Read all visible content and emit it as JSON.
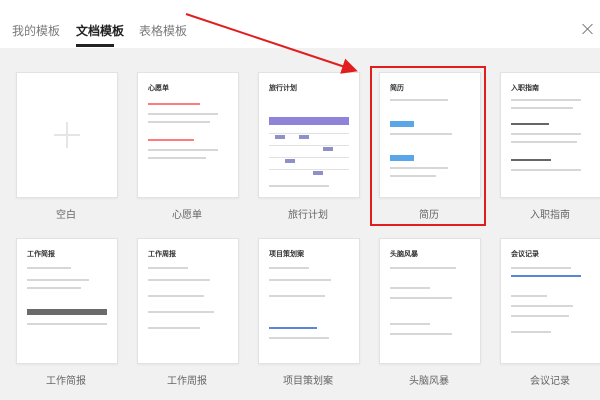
{
  "tabs": {
    "items": [
      {
        "id": "mine",
        "label": "我的模板"
      },
      {
        "id": "docs",
        "label": "文档模板"
      },
      {
        "id": "sheets",
        "label": "表格模板"
      }
    ],
    "active": "docs"
  },
  "templates_row1": [
    {
      "id": "blank",
      "label": "空白"
    },
    {
      "id": "wishlist",
      "label": "心愿单",
      "card_title": "心愿单"
    },
    {
      "id": "travel",
      "label": "旅行计划",
      "card_title": "旅行计划"
    },
    {
      "id": "resume",
      "label": "简历",
      "card_title": "简历"
    },
    {
      "id": "onboarding",
      "label": "入职指南",
      "card_title": "入职指南"
    }
  ],
  "templates_row2": [
    {
      "id": "weekly-report-1",
      "label": "工作简报",
      "card_title": "工作简报"
    },
    {
      "id": "weekly-report-2",
      "label": "工作周报",
      "card_title": "工作周报"
    },
    {
      "id": "project-plan",
      "label": "项目策划案",
      "card_title": "项目策划案"
    },
    {
      "id": "brainstorm",
      "label": "头脑风暴",
      "card_title": "头脑风暴"
    },
    {
      "id": "meeting-notes",
      "label": "会议记录",
      "card_title": "会议记录"
    }
  ],
  "colors": {
    "highlight": "#e11d1d",
    "active_tab": "#222222"
  },
  "icons": {
    "close": "close-icon",
    "add": "plus-icon"
  }
}
